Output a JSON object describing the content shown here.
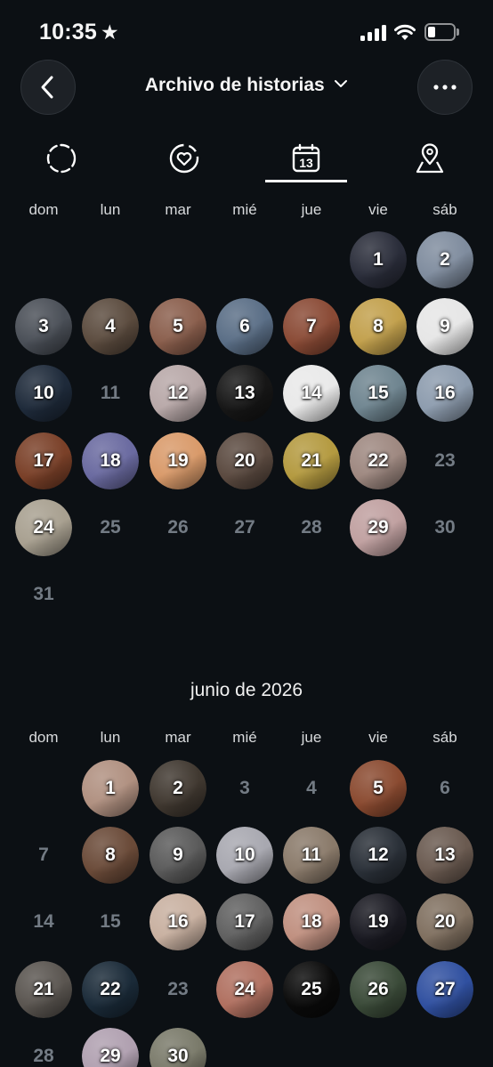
{
  "status_bar": {
    "time": "10:35",
    "star": "★"
  },
  "header": {
    "title": "Archivo de historias",
    "back_icon": "chevron-left-icon",
    "more_icon": "more-horizontal-icon",
    "dropdown_icon": "chevron-down-icon"
  },
  "tabs": [
    {
      "name": "stories",
      "icon": "dashed-circle-icon",
      "active": false
    },
    {
      "name": "highlights",
      "icon": "heart-circle-icon",
      "active": false
    },
    {
      "name": "calendar",
      "icon": "calendar-icon",
      "calendar_day": "13",
      "active": true
    },
    {
      "name": "map",
      "icon": "map-pin-icon",
      "active": false
    }
  ],
  "weekdays": [
    "dom",
    "lun",
    "mar",
    "mié",
    "jue",
    "vie",
    "sáb"
  ],
  "months": [
    {
      "title": "",
      "first_weekday": 5,
      "days_in_month": 31,
      "story_days": {
        "1": "#2a2d3a",
        "2": "#7f8c9e",
        "3": "#4a4f57",
        "4": "#5b4b3e",
        "5": "#8a5e4c",
        "6": "#5a6e86",
        "7": "#8a4a35",
        "8": "#c2a04c",
        "9": "#e6e6e6",
        "10": "#1e2a3a",
        "12": "#b8a8a8",
        "13": "#161616",
        "14": "#e9e9e9",
        "15": "#6f8590",
        "16": "#8d9cae",
        "17": "#7a4028",
        "18": "#6a6aa0",
        "19": "#d99a6a",
        "20": "#5b4a40",
        "21": "#b49a40",
        "22": "#9e8880",
        "24": "#a8a090",
        "29": "#c0a0a0"
      }
    },
    {
      "title": "junio de 2026",
      "first_weekday": 1,
      "days_in_month": 30,
      "story_days": {
        "1": "#b09080",
        "2": "#403830",
        "5": "#8a4a30",
        "8": "#6a4a38",
        "9": "#5a5a5a",
        "10": "#a8a8b0",
        "11": "#8a7a6a",
        "12": "#2a3038",
        "13": "#6a5a50",
        "16": "#c8b0a0",
        "17": "#606060",
        "18": "#c09080",
        "19": "#1a1a22",
        "20": "#807060",
        "21": "#5a5550",
        "22": "#1a2a38",
        "24": "#b07060",
        "25": "#0a0a0a",
        "26": "#3a4a38",
        "27": "#3050a0",
        "29": "#b0a0b0",
        "30": "#7a7a6a"
      }
    }
  ]
}
